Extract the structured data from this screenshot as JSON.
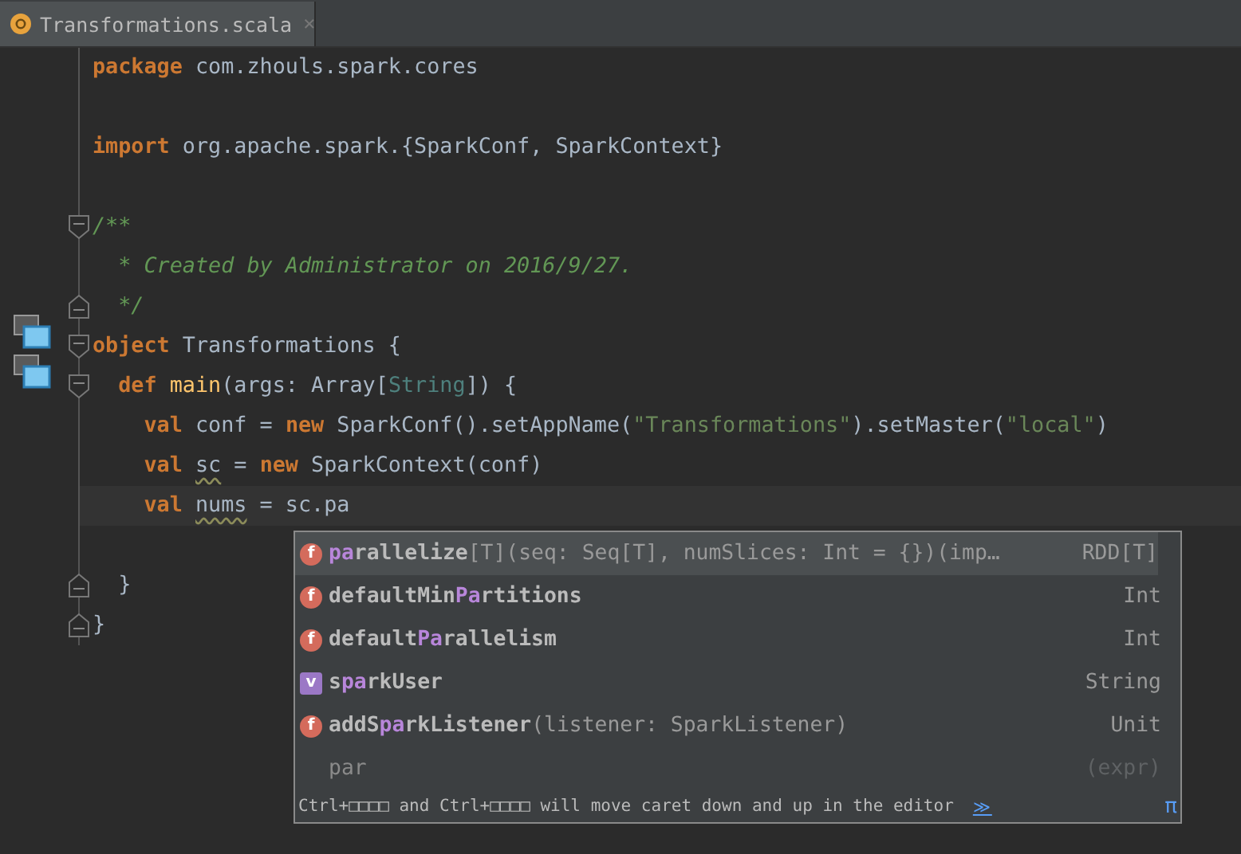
{
  "tab": {
    "title": "Transformations.scala",
    "close": "×",
    "selected": true
  },
  "lines": [
    {
      "tokens": [
        {
          "kind": "kw",
          "text": "package"
        },
        {
          "kind": "plain",
          "text": " com.zhouls.spark.cores"
        }
      ]
    },
    {
      "kind": "blank"
    },
    {
      "tokens": [
        {
          "kind": "kw",
          "text": "import"
        },
        {
          "kind": "plain",
          "text": " org.apache.spark.{SparkConf, SparkContext}"
        }
      ]
    },
    {
      "kind": "blank"
    },
    {
      "gutter": [
        {
          "kind": "fold_open"
        }
      ],
      "tokens": [
        {
          "kind": "comment",
          "text": "/**"
        }
      ]
    },
    {
      "tokens": [
        {
          "kind": "comment",
          "text": "  * Created by Administrator on 2016/9/27."
        }
      ]
    },
    {
      "gutter": [
        {
          "kind": "fold_close"
        }
      ],
      "tokens": [
        {
          "kind": "comment",
          "text": "  */"
        }
      ]
    },
    {
      "gutter": [
        {
          "kind": "implementation"
        },
        {
          "kind": "fold_open"
        }
      ],
      "tokens": [
        {
          "kind": "kw",
          "text": "object"
        },
        {
          "kind": "plain",
          "text": " Transformations {"
        }
      ]
    },
    {
      "gutter": [
        {
          "kind": "implementation"
        },
        {
          "kind": "fold_open"
        }
      ],
      "tokens": [
        {
          "kind": "kw",
          "text": "  def"
        },
        {
          "kind": "fn",
          "text": " main"
        },
        {
          "kind": "plain",
          "text": "(args: Array["
        },
        {
          "kind": "type",
          "text": "String"
        },
        {
          "kind": "plain",
          "text": "]) {"
        }
      ]
    },
    {
      "tokens": [
        {
          "kind": "kw",
          "text": "    val"
        },
        {
          "kind": "plain",
          "text": " conf = "
        },
        {
          "kind": "kw",
          "text": "new"
        },
        {
          "kind": "plain",
          "text": " SparkConf().setAppName("
        },
        {
          "kind": "string",
          "text": "\"Transformations\""
        },
        {
          "kind": "plain",
          "text": ").setMaster("
        },
        {
          "kind": "string",
          "text": "\"local\""
        },
        {
          "kind": "plain",
          "text": ")"
        }
      ]
    },
    {
      "tokens": [
        {
          "kind": "kw",
          "text": "    val "
        },
        {
          "kind": "warn",
          "text": "sc"
        },
        {
          "kind": "plain",
          "text": " = "
        },
        {
          "kind": "kw",
          "text": "new"
        },
        {
          "kind": "plain",
          "text": " SparkContext(conf)"
        }
      ]
    },
    {
      "current": true,
      "tokens": [
        {
          "kind": "kw",
          "text": "    val "
        },
        {
          "kind": "warn",
          "text": "nums"
        },
        {
          "kind": "plain",
          "text": " = sc.pa"
        }
      ]
    },
    {
      "kind": "blank"
    },
    {
      "gutter": [
        {
          "kind": "fold_close"
        }
      ],
      "tokens": [
        {
          "kind": "plain",
          "text": "  }"
        }
      ]
    },
    {
      "gutter": [
        {
          "kind": "fold_close"
        }
      ],
      "tokens": [
        {
          "kind": "plain",
          "text": "}"
        }
      ]
    }
  ],
  "completion": {
    "items": [
      {
        "kind": "method",
        "icon": "f",
        "selected": true,
        "name": [
          {
            "text": "pa",
            "match": true
          },
          {
            "text": "rallelize",
            "match": false
          }
        ],
        "signature": "[T](seq: Seq[T], numSlices: Int = {})(imp…",
        "type": "RDD[T]"
      },
      {
        "kind": "method",
        "icon": "f",
        "selected": false,
        "name": [
          {
            "text": "defaultMin",
            "match": false
          },
          {
            "text": "Pa",
            "match": true
          },
          {
            "text": "rtitions",
            "match": false
          }
        ],
        "type": "Int"
      },
      {
        "kind": "method",
        "icon": "f",
        "selected": false,
        "name": [
          {
            "text": "default",
            "match": false
          },
          {
            "text": "Pa",
            "match": true
          },
          {
            "text": "rallelism",
            "match": false
          }
        ],
        "type": "Int"
      },
      {
        "kind": "value",
        "icon": "v",
        "selected": false,
        "name": [
          {
            "text": "s",
            "match": false
          },
          {
            "text": "pa",
            "match": true
          },
          {
            "text": "rkUser",
            "match": false
          }
        ],
        "type": "String"
      },
      {
        "kind": "method",
        "icon": "f",
        "selected": false,
        "name": [
          {
            "text": "addS",
            "match": false
          },
          {
            "text": "pa",
            "match": true
          },
          {
            "text": "rkListener",
            "match": false
          }
        ],
        "signature": "(listener: SparkListener)",
        "type": "Unit"
      },
      {
        "kind": "plain",
        "selected": false,
        "name": [
          {
            "text": "par",
            "match": false
          }
        ],
        "type": "(expr)"
      }
    ],
    "hint": "Ctrl+□□□□ and Ctrl+□□□□ will move caret down and up in the editor",
    "hint_link": "≫",
    "corner": "π"
  }
}
